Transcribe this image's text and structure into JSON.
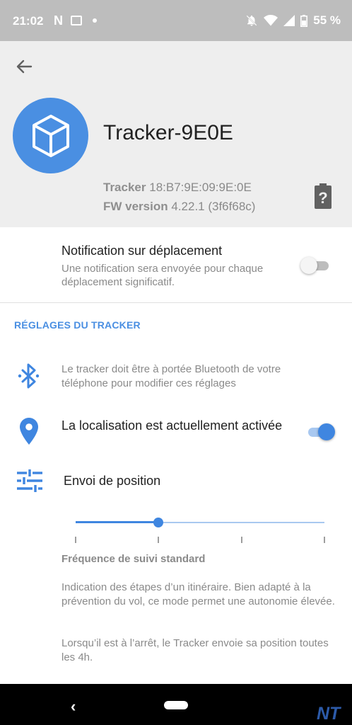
{
  "status_bar": {
    "time": "21:02",
    "notif_letter": "N",
    "battery_pct": "55 %"
  },
  "header": {
    "device_name": "Tracker-9E0E",
    "tracker_label": "Tracker",
    "tracker_id": "18:B7:9E:09:9E:0E",
    "fw_label": "FW version",
    "fw_value": "4.22.1 (3f6f68c)",
    "battery_unknown_glyph": "?"
  },
  "notification": {
    "title": "Notification sur déplacement",
    "description": "Une notification sera envoyée pour chaque déplacement significatif.",
    "enabled": false
  },
  "tracker_settings": {
    "section_title": "RÉGLAGES DU TRACKER",
    "bluetooth_hint": "Le tracker doit être à portée Bluetooth de votre téléphone pour modifier ces réglages",
    "location_label": "La localisation est actuellement activée",
    "location_enabled": true,
    "position_label": "Envoi de position",
    "slider": {
      "steps": 4,
      "selected_index": 1
    },
    "frequency_title": "Fréquence de suivi standard",
    "frequency_description": "Indication des étapes d’un itinéraire. Bien adapté à la prévention du vol, ce mode permet une autonomie élevée.",
    "frequency_note": "Lorsqu’il est à l’arrêt, le Tracker envoie sa position toutes les 4h."
  },
  "nav_bar": {
    "back_glyph": "‹",
    "watermark": "NT"
  },
  "colors": {
    "accent": "#4a8fe2",
    "status_bar": "#bdbdbd",
    "header_bg": "#eeeeee"
  },
  "icons": {
    "back": "arrow-left-icon",
    "device": "cube-icon",
    "battery": "battery-unknown-icon",
    "bluetooth": "bluetooth-icon",
    "location": "location-pin-icon",
    "tune": "tune-sliders-icon"
  }
}
